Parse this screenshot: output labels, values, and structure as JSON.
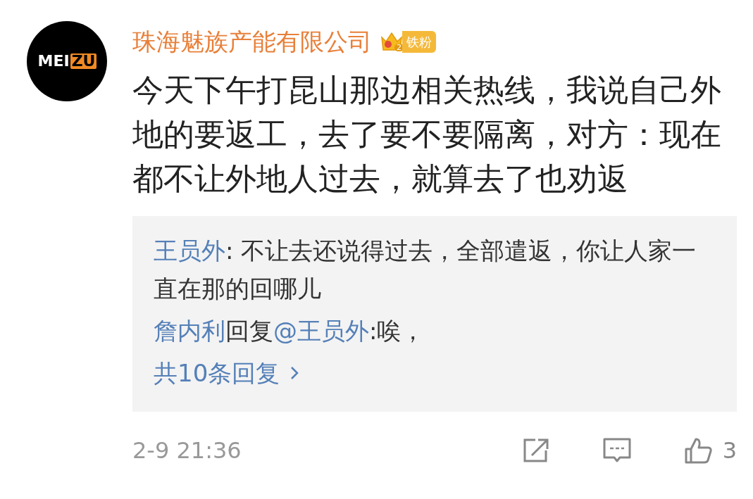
{
  "comment": {
    "avatar": {
      "text_a": "MEI",
      "text_b": "ZU"
    },
    "author": "珠海魅族产能有限公司",
    "badge": {
      "level": "2",
      "label": "铁粉"
    },
    "text": "今天下午打昆山那边相关热线，我说自己外地的要返工，去了要不要隔离，对方：现在都不让外地人过去，就算去了也劝返",
    "replies": [
      {
        "author": "王员外",
        "separator": ": ",
        "text": "不让去还说得过去，全部遣返，你让人家一直在那的回哪儿"
      },
      {
        "author": "詹内利",
        "reply_word": "回复",
        "mention": "@王员外",
        "text": ":唉，"
      }
    ],
    "more_replies": "共10条回复",
    "time": "2-9 21:36",
    "likes": "3"
  }
}
